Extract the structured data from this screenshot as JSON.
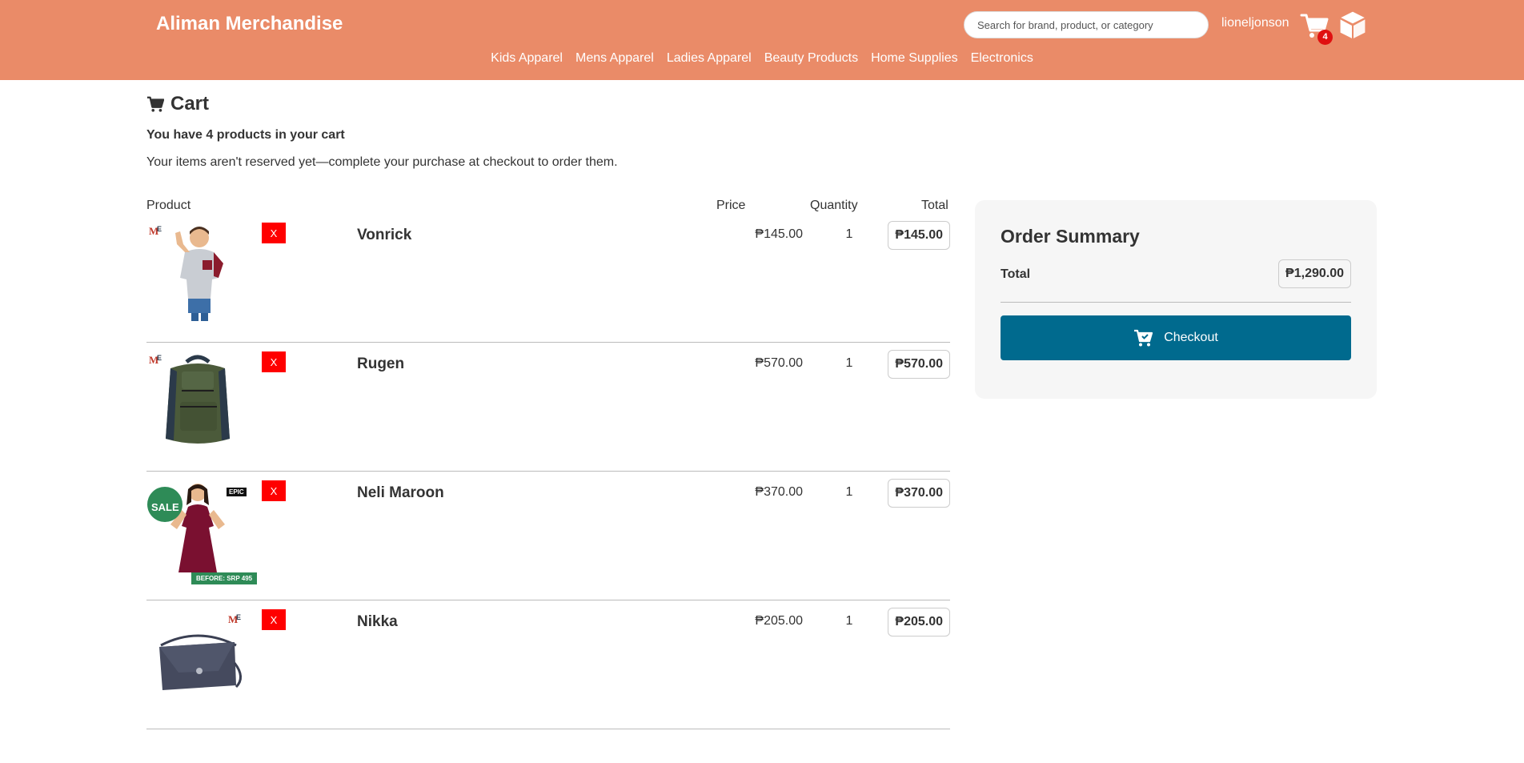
{
  "header": {
    "brand": "Aliman Merchandise",
    "search_placeholder": "Search for brand, product, or category",
    "username": "lioneljonson",
    "cart_count": "4",
    "nav": [
      "Kids Apparel",
      "Mens Apparel",
      "Ladies Apparel",
      "Beauty Products",
      "Home Supplies",
      "Electronics"
    ],
    "colors": {
      "header_bg": "#ea8b68",
      "badge": "#e01010"
    }
  },
  "cart": {
    "title": "Cart",
    "count_text": "You have 4 products in your cart",
    "note": "Your items aren't reserved yet—complete your purchase at checkout to order them.",
    "columns": {
      "product": "Product",
      "price": "Price",
      "quantity": "Quantity",
      "total": "Total"
    },
    "remove_label": "X",
    "items": [
      {
        "name": "Vonrick",
        "price": "₱145.00",
        "quantity": "1",
        "total": "₱145.00",
        "image": "kid-shirt-thumbnail"
      },
      {
        "name": "Rugen",
        "price": "₱570.00",
        "quantity": "1",
        "total": "₱570.00",
        "image": "backpack-thumbnail"
      },
      {
        "name": "Neli Maroon",
        "price": "₱370.00",
        "quantity": "1",
        "total": "₱370.00",
        "image": "dress-thumbnail",
        "badges": {
          "sale": "SALE",
          "epic": "EPIC",
          "before": "BEFORE: SRP 495"
        }
      },
      {
        "name": "Nikka",
        "price": "₱205.00",
        "quantity": "1",
        "total": "₱205.00",
        "image": "bag-thumbnail"
      }
    ]
  },
  "summary": {
    "title": "Order Summary",
    "total_label": "Total",
    "total_value": "₱1,290.00",
    "checkout_label": "Checkout",
    "colors": {
      "checkout_bg": "#006a8e",
      "remove_bg": "#ff0000"
    }
  }
}
